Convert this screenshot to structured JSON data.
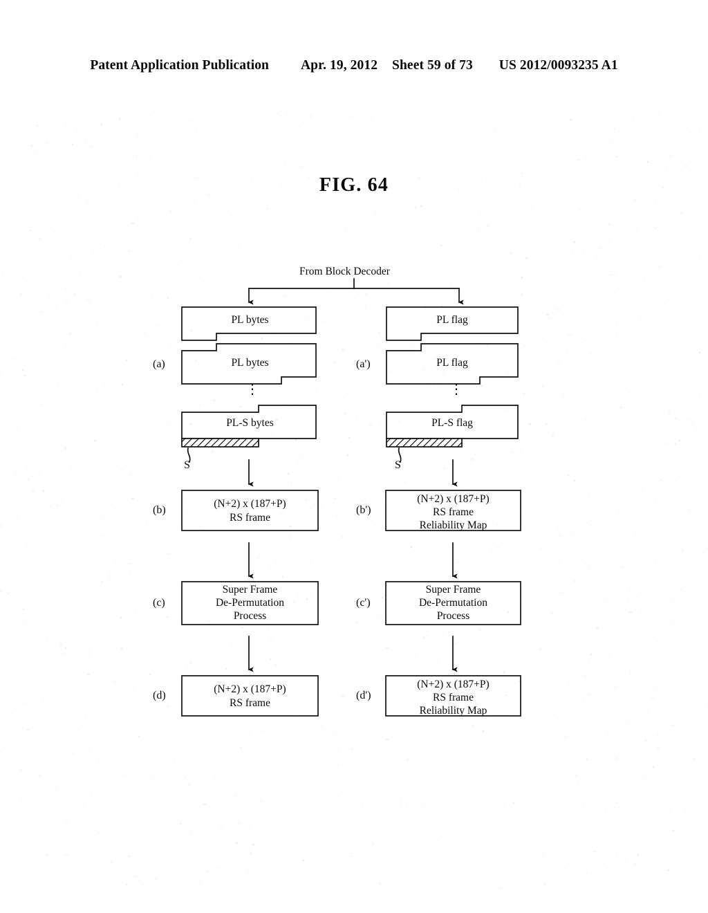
{
  "header": {
    "publication": "Patent Application Publication",
    "date": "Apr. 19, 2012",
    "sheet": "Sheet 59 of 73",
    "number": "US 2012/0093235 A1"
  },
  "figure": {
    "title": "FIG. 64",
    "source_label": "From Block Decoder"
  },
  "columns": {
    "left": {
      "row_markers": {
        "a": "(a)",
        "b": "(b)",
        "c": "(c)",
        "d": "(d)"
      },
      "stack": {
        "items": [
          {
            "label": "PL bytes"
          },
          {
            "label": "PL bytes"
          },
          {
            "label": "PL-S bytes"
          }
        ],
        "ellipsis": "⋮",
        "parity_marker": "S"
      },
      "rs_frame": {
        "line1": "(N+2) x (187+P)",
        "line2": "RS frame"
      },
      "process": {
        "line1": "Super Frame",
        "line2": "De-Permutation",
        "line3": "Process"
      },
      "rs_frame_out": {
        "line1": "(N+2) x (187+P)",
        "line2": "RS frame"
      }
    },
    "right": {
      "row_markers": {
        "a": "(a')",
        "b": "(b')",
        "c": "(c')",
        "d": "(d')"
      },
      "stack": {
        "items": [
          {
            "label": "PL flag"
          },
          {
            "label": "PL flag"
          },
          {
            "label": "PL-S flag"
          }
        ],
        "ellipsis": "⋮",
        "parity_marker": "S"
      },
      "rs_frame": {
        "line1": "(N+2) x (187+P)",
        "line2": "RS frame",
        "line3": "Reliability Map"
      },
      "process": {
        "line1": "Super Frame",
        "line2": "De-Permutation",
        "line3": "Process"
      },
      "rs_frame_out": {
        "line1": "(N+2) x (187+P)",
        "line2": "RS frame",
        "line3": "Reliability Map"
      }
    }
  },
  "style": {
    "ink": "#0a0a0a",
    "paper": "#ffffff"
  }
}
